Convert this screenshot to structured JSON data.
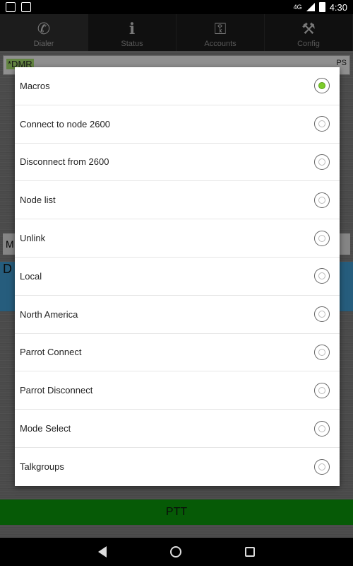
{
  "status_bar": {
    "time": "4:30",
    "network": "4G"
  },
  "tabs": [
    {
      "label": "Dialer",
      "icon": "phone-icon",
      "glyph": "✆",
      "active": true
    },
    {
      "label": "Status",
      "icon": "info-icon",
      "glyph": "ℹ",
      "active": false
    },
    {
      "label": "Accounts",
      "icon": "key-icon",
      "glyph": "⚿",
      "active": false
    },
    {
      "label": "Config",
      "icon": "tools-icon",
      "glyph": "⚒",
      "active": false
    }
  ],
  "background": {
    "field_text": "*DMR",
    "field_suffix": "PS",
    "row_letter": "M",
    "blue_letter": "D"
  },
  "dialog": {
    "options": [
      {
        "label": "Macros",
        "checked": true
      },
      {
        "label": "Connect to node 2600",
        "checked": false
      },
      {
        "label": "Disconnect from 2600",
        "checked": false
      },
      {
        "label": "Node list",
        "checked": false
      },
      {
        "label": "Unlink",
        "checked": false
      },
      {
        "label": "Local",
        "checked": false
      },
      {
        "label": "North America",
        "checked": false
      },
      {
        "label": "Parrot Connect",
        "checked": false
      },
      {
        "label": "Parrot Disconnect",
        "checked": false
      },
      {
        "label": "Mode Select",
        "checked": false
      },
      {
        "label": "Talkgroups",
        "checked": false
      }
    ]
  },
  "ptt": {
    "label": "PTT"
  },
  "colors": {
    "selected_radio": "#7ccc2a",
    "ptt": "#0a8a0a"
  }
}
